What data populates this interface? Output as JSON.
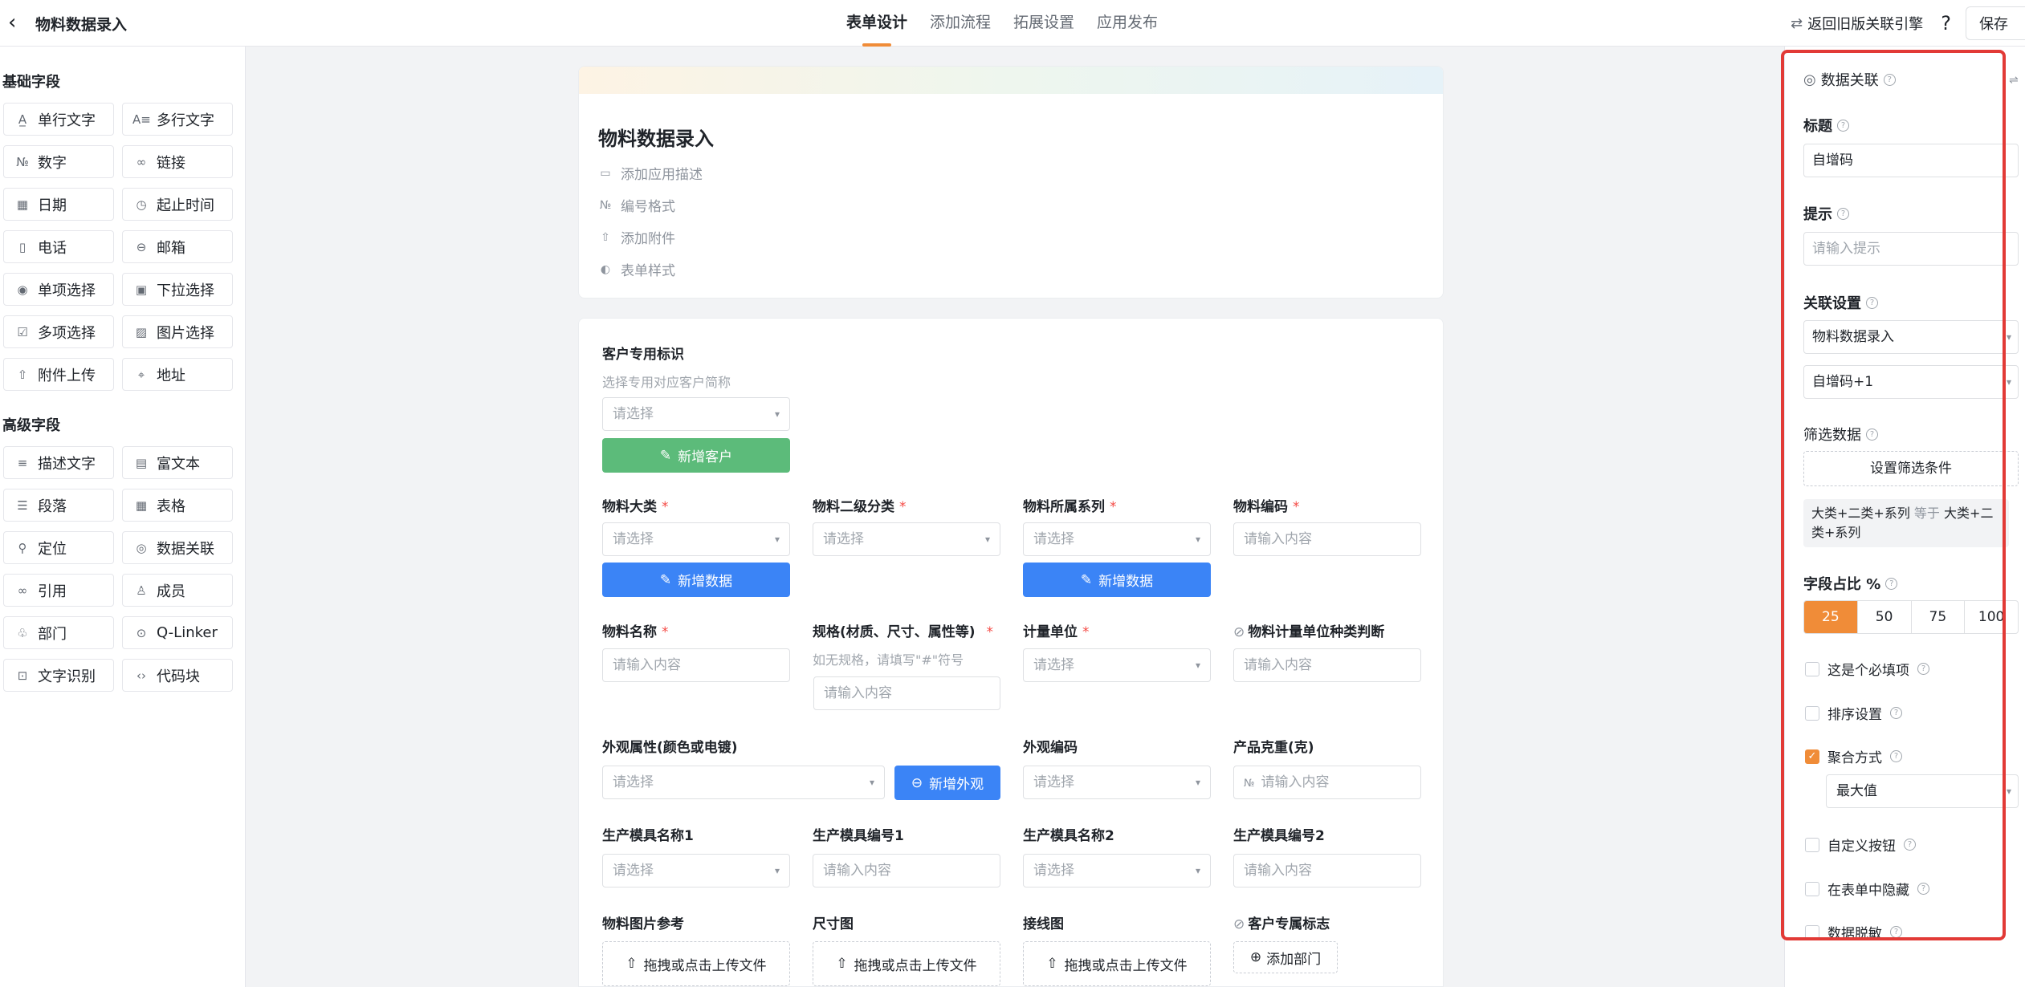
{
  "header": {
    "back_icon": "chevron-left-icon",
    "title": "物料数据录入",
    "tabs": [
      {
        "label": "表单设计",
        "active": true
      },
      {
        "label": "添加流程",
        "active": false
      },
      {
        "label": "拓展设置",
        "active": false
      },
      {
        "label": "应用发布",
        "active": false
      }
    ],
    "legacy_link": "返回旧版关联引擎",
    "help": "?",
    "save": "保存"
  },
  "left_panel": {
    "basic_title": "基础字段",
    "basic_fields": [
      {
        "label": "单行文字",
        "icon": "A̲"
      },
      {
        "label": "多行文字",
        "icon": "A≡"
      },
      {
        "label": "数字",
        "icon": "№"
      },
      {
        "label": "链接",
        "icon": "🔗"
      },
      {
        "label": "日期",
        "icon": "▦"
      },
      {
        "label": "起止时间",
        "icon": "◷"
      },
      {
        "label": "电话",
        "icon": "▯"
      },
      {
        "label": "邮箱",
        "icon": "⊖"
      },
      {
        "label": "单项选择",
        "icon": "◉"
      },
      {
        "label": "下拉选择",
        "icon": "▣"
      },
      {
        "label": "多项选择",
        "icon": "☑"
      },
      {
        "label": "图片选择",
        "icon": "▨"
      },
      {
        "label": "附件上传",
        "icon": "⇧"
      },
      {
        "label": "地址",
        "icon": "⌖"
      }
    ],
    "advanced_title": "高级字段",
    "advanced_fields": [
      {
        "label": "描述文字",
        "icon": "≡"
      },
      {
        "label": "富文本",
        "icon": "▤"
      },
      {
        "label": "段落",
        "icon": "☰"
      },
      {
        "label": "表格",
        "icon": "▦"
      },
      {
        "label": "定位",
        "icon": "⚲"
      },
      {
        "label": "数据关联",
        "icon": "◎"
      },
      {
        "label": "引用",
        "icon": "∞"
      },
      {
        "label": "成员",
        "icon": "♙"
      },
      {
        "label": "部门",
        "icon": "♧"
      },
      {
        "label": "Q-Linker",
        "icon": "⊙"
      },
      {
        "label": "文字识别",
        "icon": "⊡"
      },
      {
        "label": "代码块",
        "icon": "‹›"
      }
    ]
  },
  "form_header": {
    "title": "物料数据录入",
    "links": [
      {
        "label": "添加应用描述",
        "icon": "▭"
      },
      {
        "label": "编号格式",
        "icon": "№"
      },
      {
        "label": "添加附件",
        "icon": "⇧"
      },
      {
        "label": "表单样式",
        "icon": "◐"
      }
    ]
  },
  "form": {
    "customer_mark": {
      "label": "客户专用标识",
      "hint": "选择专用对应客户简称",
      "placeholder": "请选择",
      "button": "新增客户"
    },
    "row1": [
      {
        "label": "物料大类",
        "required": "*",
        "placeholder": "请选择",
        "button": "新增数据"
      },
      {
        "label": "物料二级分类",
        "required": "*",
        "placeholder": "请选择"
      },
      {
        "label": "物料所属系列",
        "required": "*",
        "placeholder": "请选择",
        "button": "新增数据"
      },
      {
        "label": "物料编码",
        "required": "*",
        "placeholder": "请输入内容"
      }
    ],
    "row2": [
      {
        "label": "物料名称",
        "required": "*",
        "placeholder": "请输入内容"
      },
      {
        "label": "规格(材质、尺寸、属性等)",
        "required": "*",
        "hint": "如无规格，请填写\"#\"符号",
        "placeholder": "请输入内容"
      },
      {
        "label": "计量单位",
        "required": "*",
        "placeholder": "请选择"
      },
      {
        "label": "物料计量单位种类判断",
        "placeholder": "请输入内容"
      }
    ],
    "row3": [
      {
        "label": "外观属性(颜色或电镀)",
        "placeholder": "请选择",
        "button": "新增外观"
      },
      {
        "label": "外观编码",
        "placeholder": "请选择"
      },
      {
        "label": "产品克重(克)",
        "placeholder": "请输入内容"
      }
    ],
    "row4": [
      {
        "label": "生产模具名称1",
        "placeholder": "请选择"
      },
      {
        "label": "生产模具编号1",
        "placeholder": "请输入内容"
      },
      {
        "label": "生产模具名称2",
        "placeholder": "请选择"
      },
      {
        "label": "生产模具编号2",
        "placeholder": "请输入内容"
      }
    ],
    "row5": [
      {
        "label": "物料图片参考",
        "upload": "拖拽或点击上传文件"
      },
      {
        "label": "尺寸图",
        "upload": "拖拽或点击上传文件"
      },
      {
        "label": "接线图",
        "upload": "拖拽或点击上传文件"
      },
      {
        "label": "客户专属标志",
        "button": "添加部门"
      }
    ]
  },
  "right_panel": {
    "component": "数据关联",
    "title_label": "标题",
    "title_value": "自增码",
    "hint_label": "提示",
    "hint_placeholder": "请输入提示",
    "link_label": "关联设置",
    "link_form": "物料数据录入",
    "link_field": "自增码+1",
    "filter_label": "筛选数据",
    "filter_button": "设置筛选条件",
    "filter_left": "大类+二类+系列",
    "filter_op": "等于",
    "filter_right_1": "大类+二",
    "filter_right_2": "类+系列",
    "ratio_label": "字段占比 %",
    "ratios": [
      "25",
      "50",
      "75",
      "100"
    ],
    "ratio_selected": "25",
    "checks": [
      {
        "label": "这是个必填项",
        "checked": false
      },
      {
        "label": "排序设置",
        "checked": false
      },
      {
        "label": "聚合方式",
        "checked": true
      },
      {
        "label": "自定义按钮",
        "checked": false
      },
      {
        "label": "在表单中隐藏",
        "checked": false
      },
      {
        "label": "数据脱敏",
        "checked": false
      }
    ],
    "aggregate_value": "最大值"
  },
  "colors": {
    "accent": "#f08c38",
    "green": "#5cbb7a",
    "blue": "#3b84f6",
    "highlight": "#e23a36"
  }
}
